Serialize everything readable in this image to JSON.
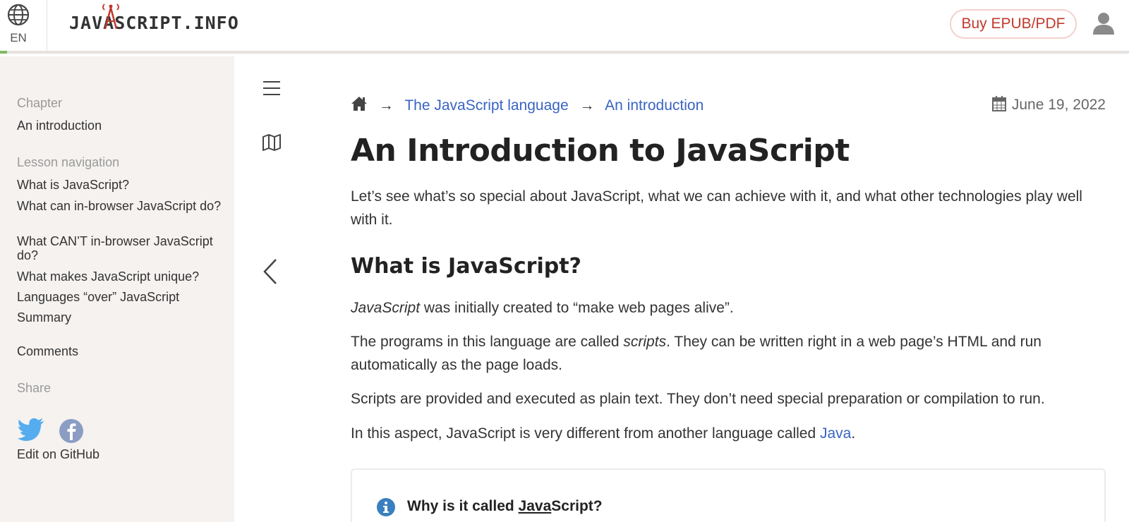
{
  "header": {
    "lang_code": "EN",
    "logo_text": "JAVASCRIPT.INFO",
    "buy_label": "Buy EPUB/PDF"
  },
  "sidebar": {
    "chapter_label": "Chapter",
    "chapter_link": "An introduction",
    "lesson_nav_label": "Lesson navigation",
    "lessons": [
      "What is JavaScript?",
      "What can in-browser JavaScript do?",
      "What CAN’T in-browser JavaScript do?",
      "What makes JavaScript unique?",
      "Languages “over” JavaScript",
      "Summary"
    ],
    "comments_link": "Comments",
    "share_label": "Share",
    "edit_link": "Edit on GitHub"
  },
  "breadcrumbs": {
    "items": [
      "The JavaScript language",
      "An introduction"
    ],
    "separator": "→"
  },
  "article": {
    "date": "June 19, 2022",
    "title": "An Introduction to JavaScript",
    "intro": "Let’s see what’s so special about JavaScript, what we can achieve with it, and what other technologies play well with it.",
    "section_title": "What is JavaScript?",
    "p1_em": "JavaScript",
    "p1_rest": " was initially created to “make web pages alive”.",
    "p2_a": "The programs in this language are called ",
    "p2_em": "scripts",
    "p2_b": ". They can be written right in a web page’s HTML and run automatically as the page loads.",
    "p3": "Scripts are provided and executed as plain text. They don’t need special preparation or compilation to run.",
    "p4_a": "In this aspect, JavaScript is very different from another language called ",
    "p4_link": "Java",
    "p4_b": ".",
    "note_title_a": "Why is it called ",
    "note_title_u": "Java",
    "note_title_b": "Script?"
  },
  "colors": {
    "link": "#3964c3",
    "accent_red": "#c0392b",
    "sidebar_bg": "#f5f2f0",
    "twitter": "#55acee",
    "facebook": "#8b9dc3"
  },
  "icons": {
    "lang": "globe-icon",
    "user": "user-icon",
    "menu": "hamburger-icon",
    "map": "map-icon",
    "prev": "chevron-left-icon",
    "home": "home-icon",
    "calendar": "calendar-icon",
    "info": "info-icon",
    "twitter": "twitter-icon",
    "facebook": "facebook-icon"
  }
}
